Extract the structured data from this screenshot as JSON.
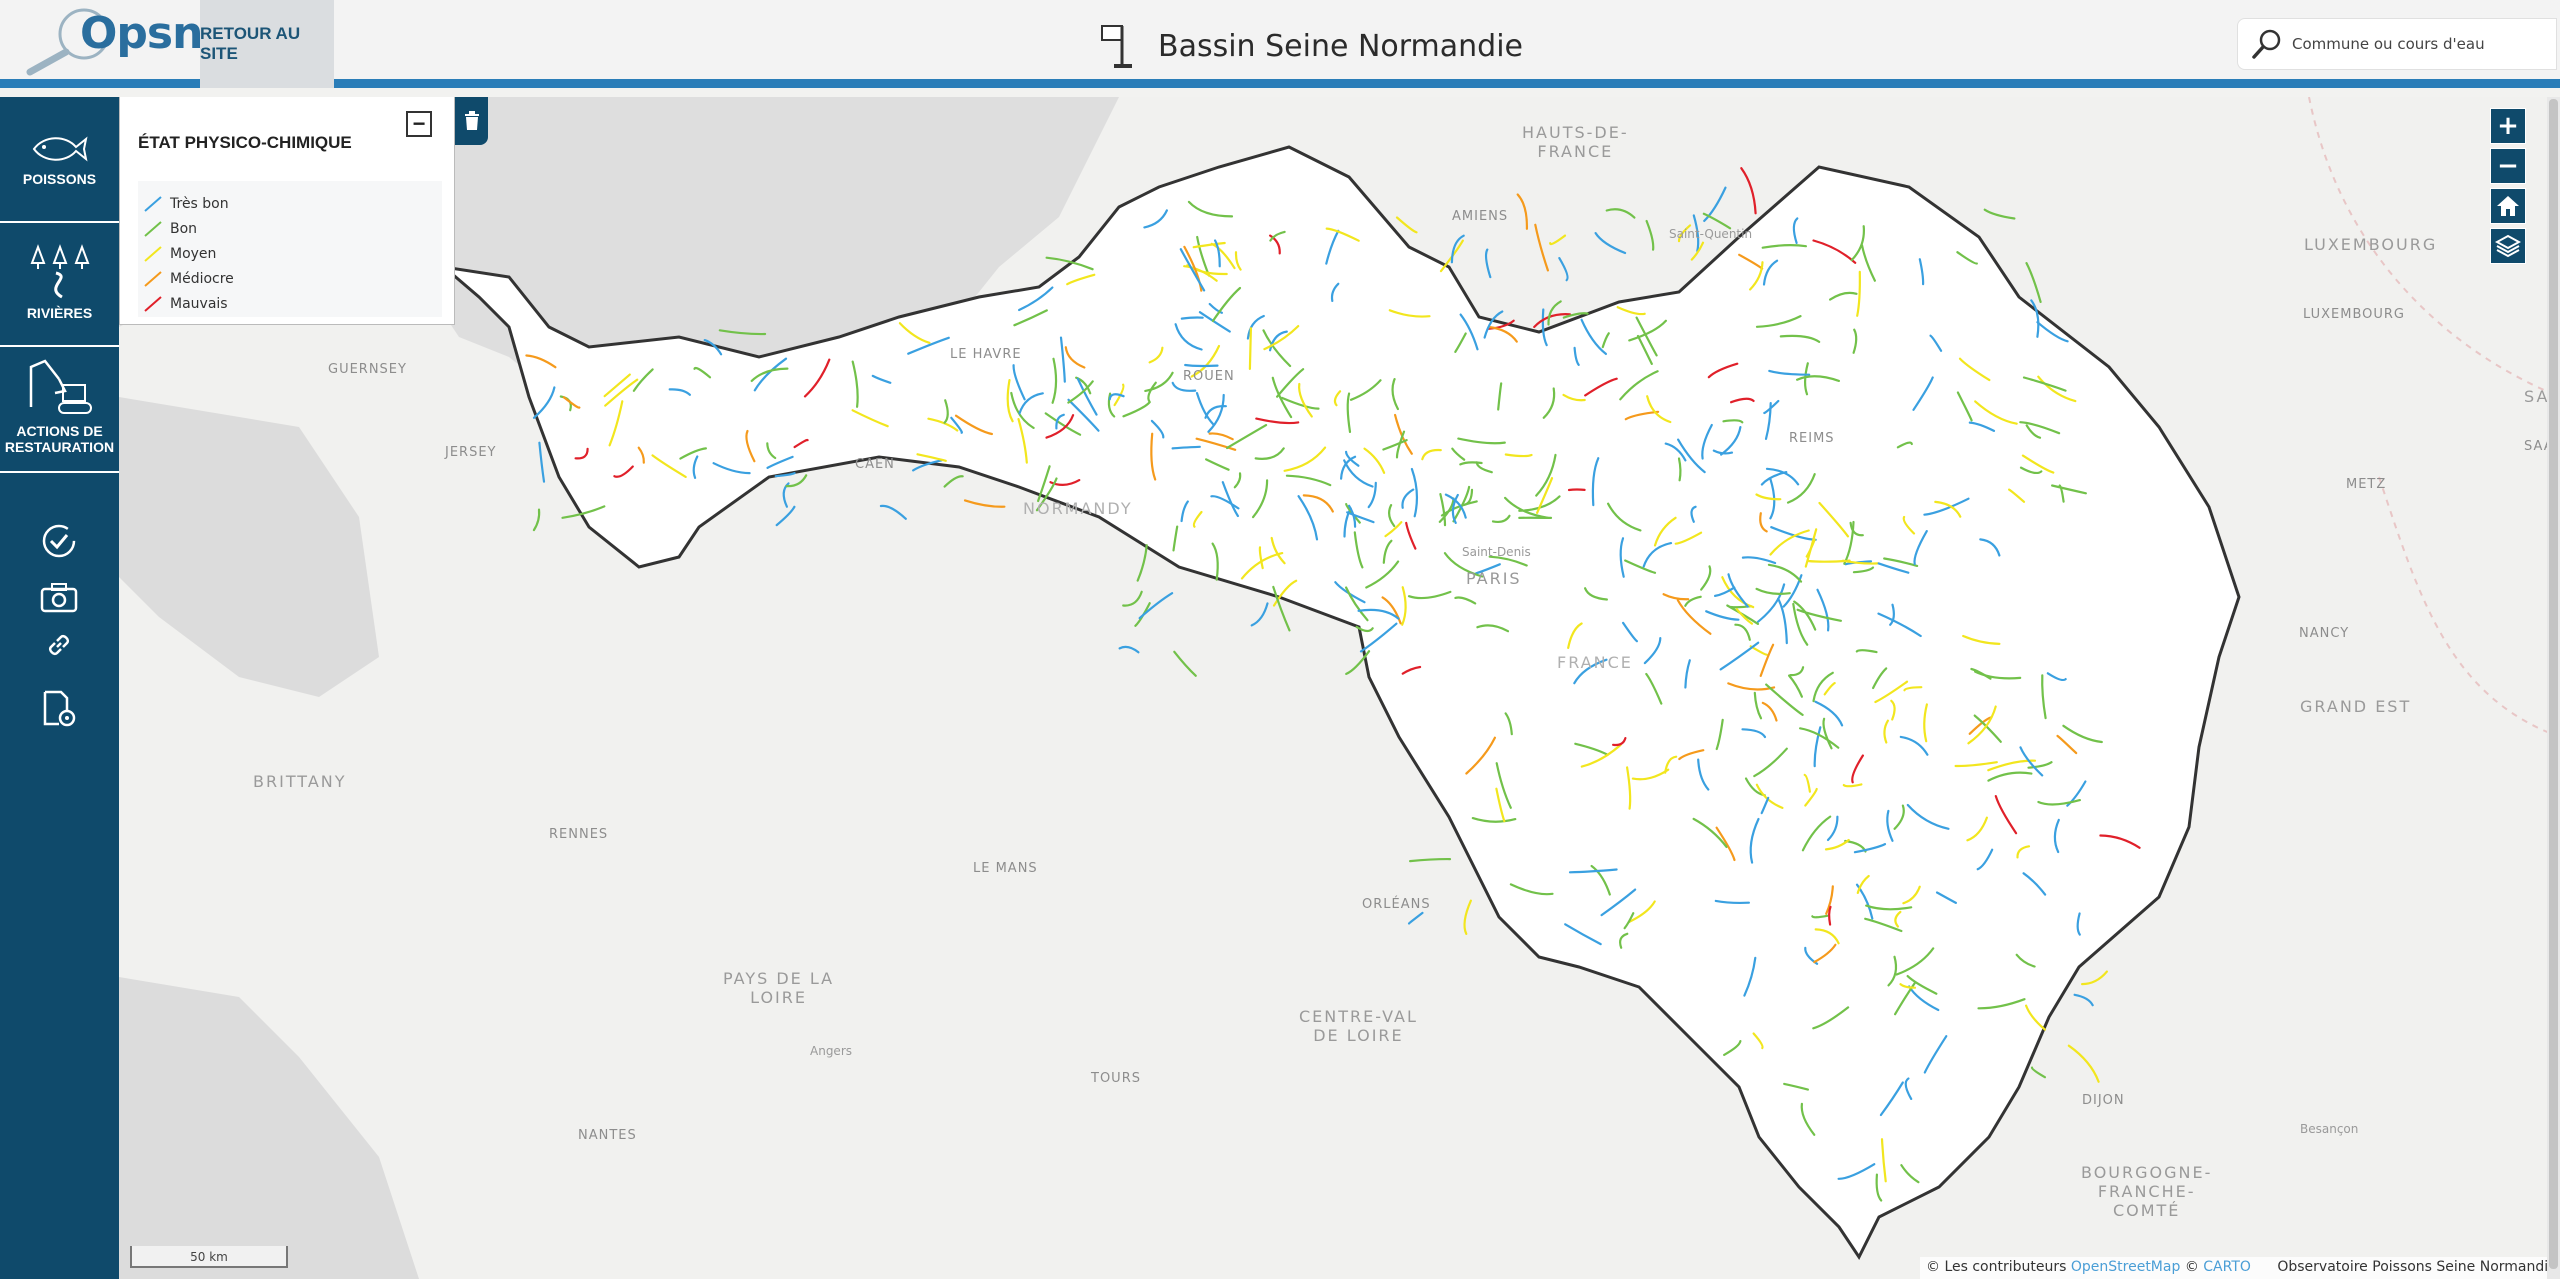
{
  "header": {
    "logo_text": "Opsn",
    "back_label": "RETOUR AU SITE",
    "title": "Bassin Seine Normandie",
    "search_placeholder": "Commune ou cours d'eau"
  },
  "sidebar": {
    "items": [
      {
        "label": "POISSONS",
        "icon": "fish-icon"
      },
      {
        "label": "RIVIÈRES",
        "icon": "trees-river-icon"
      },
      {
        "label_line1": "ACTIONS DE",
        "label_line2": "RESTAURATION",
        "icon": "excavator-icon"
      }
    ],
    "tools": [
      "refresh-check-icon",
      "camera-icon",
      "link-icon",
      "document-settings-icon"
    ]
  },
  "legend": {
    "title": "ÉTAT PHYSICO-CHIMIQUE",
    "collapse_label": "−",
    "items": [
      {
        "label": "Très bon",
        "color": "#3aa0e0"
      },
      {
        "label": "Bon",
        "color": "#72c14a"
      },
      {
        "label": "Moyen",
        "color": "#f2e61e"
      },
      {
        "label": "Médiocre",
        "color": "#f59a1c"
      },
      {
        "label": "Mauvais",
        "color": "#e0202a"
      }
    ]
  },
  "map": {
    "controls": {
      "zoom_in": "+",
      "zoom_out": "−"
    },
    "places": {
      "hauts_de_france": "HAUTS-DE-\nFRANCE",
      "amiens": "AMIENS",
      "saint_quentin": "Saint-Quentin",
      "luxembourg_region": "LUXEMBOURG",
      "luxembourg_city": "LUXEMBOURG",
      "saar": "SAAR",
      "saarb": "SAARB",
      "guernsey": "GUERNSEY",
      "jersey": "JERSEY",
      "le_havre": "LE HAVRE",
      "rouen": "ROUEN",
      "caen": "CAEN",
      "normandy": "NORMANDY",
      "reims": "REIMS",
      "metz": "METZ",
      "paris": "PARIS",
      "saint_denis": "Saint-Denis",
      "france": "FRANCE",
      "nancy": "NANCY",
      "grand_est": "GRAND EST",
      "brittany": "BRITTANY",
      "rennes": "RENNES",
      "le_mans": "LE MANS",
      "orleans": "ORLÉANS",
      "pays_de_la_loire": "PAYS DE LA\nLOIRE",
      "centre_val_de_loire": "CENTRE-VAL\nDE LOIRE",
      "angers": "Angers",
      "tours": "TOURS",
      "nantes": "NANTES",
      "dijon": "DIJON",
      "besancon": "Besançon",
      "bourgogne": "BOURGOGNE-\nFRANCHE-\nCOMTÉ"
    },
    "scale_label": "50 km"
  },
  "footer": {
    "attrib_prefix": "© Les contributeurs",
    "osm": "OpenStreetMap",
    "copy": "©",
    "carto": "CARTO",
    "site": "Observatoire Poissons Seine Normandie"
  }
}
